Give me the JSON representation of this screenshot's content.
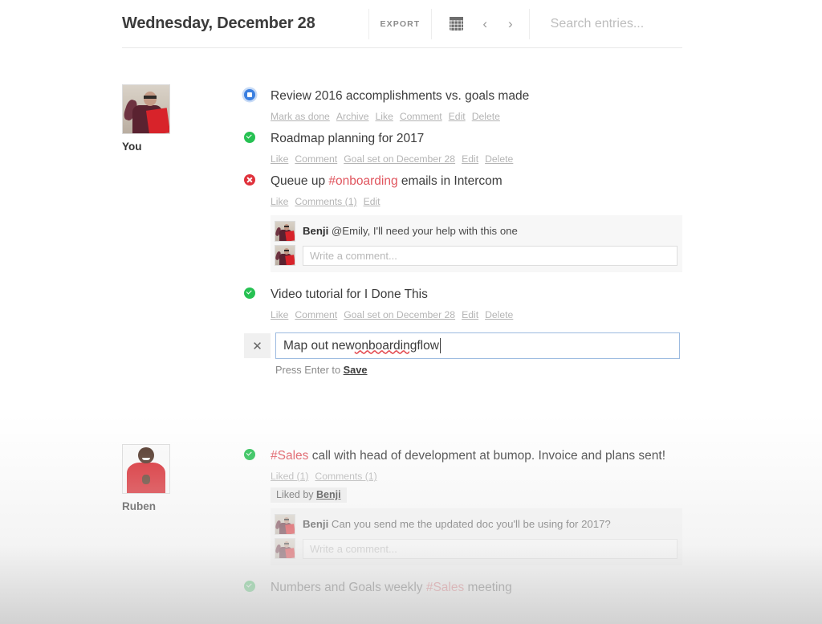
{
  "header": {
    "date_title": "Wednesday, December 28",
    "export_label": "EXPORT",
    "calendar_icon": "calendar-icon",
    "prev_icon": "‹",
    "next_icon": "›",
    "search_placeholder": "Search entries...",
    "search_value": ""
  },
  "people": [
    {
      "name": "You",
      "avatar": "avatar-you"
    },
    {
      "name": "Ruben",
      "avatar": "avatar-ruben"
    }
  ],
  "entries": [
    {
      "author": "You",
      "status": "goal",
      "text_before": "Review 2016 accomplishments vs. goals made",
      "tag": "",
      "text_after": "",
      "actions": [
        "Mark as done",
        "Archive",
        "Like",
        "Comment",
        "Edit",
        "Delete"
      ]
    },
    {
      "author": "You",
      "status": "done",
      "text_before": "Roadmap planning for 2017",
      "tag": "",
      "text_after": "",
      "actions": [
        "Like",
        "Comment",
        "Goal set on December 28",
        "Edit",
        "Delete"
      ]
    },
    {
      "author": "You",
      "status": "fail",
      "text_before": "Queue up ",
      "tag": "#onboarding",
      "text_after": " emails in Intercom",
      "actions": [
        "Like",
        "Comments (1)",
        "Edit"
      ],
      "comments": [
        {
          "author": "Benji",
          "body": "@Emily, I'll need your help with this one"
        }
      ],
      "comment_placeholder": "Write a comment..."
    },
    {
      "author": "You",
      "status": "done",
      "text_before": "Video tutorial for I Done This",
      "tag": "",
      "text_after": "",
      "actions": [
        "Like",
        "Comment",
        "Goal set on December 28",
        "Edit",
        "Delete"
      ]
    }
  ],
  "editor": {
    "close_label": "✕",
    "value_text": "Map out new ",
    "value_misspelled": "onboarding",
    "value_tail": " flow",
    "full_value": "Map out new onboarding flow",
    "hint_prefix": "Press Enter to ",
    "hint_action": "Save"
  },
  "entries2": [
    {
      "author": "Ruben",
      "status": "done",
      "text_before": "",
      "tag": "#Sales",
      "text_after": " call with head of development at bumop. Invoice and plans sent!",
      "actions": [
        "Liked (1)",
        "Comments (1)"
      ],
      "liked_by_prefix": "Liked by ",
      "liked_by_name": "Benji",
      "comments": [
        {
          "author": "Benji",
          "body": "Can you send me the updated doc you'll be using for 2017?"
        }
      ],
      "comment_placeholder": "Write a comment..."
    },
    {
      "author": "Ruben",
      "status": "done",
      "text_before": "Numbers and Goals weekly ",
      "tag": "#Sales",
      "text_after": " meeting",
      "actions": []
    }
  ],
  "colors": {
    "goal_blue": "#3a7fe0",
    "done_green": "#26c152",
    "fail_red": "#e0323c",
    "tag_red": "#e0555e",
    "focus_border": "#9dbbe0"
  }
}
